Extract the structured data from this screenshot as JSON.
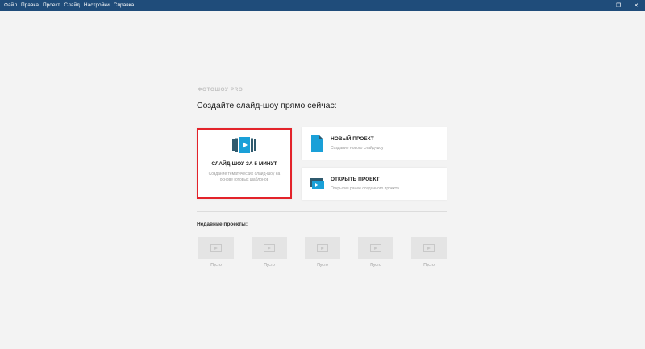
{
  "menu": [
    "Файл",
    "Правка",
    "Проект",
    "Слайд",
    "Настройки",
    "Справка"
  ],
  "window_controls": {
    "minimize": "—",
    "maximize": "❐",
    "close": "✕"
  },
  "brand": "ФОТОШОУ PRO",
  "heading": "Создайте слайд-шоу прямо сейчас:",
  "quick": {
    "title": "СЛАЙД-ШОУ ЗА 5 МИНУТ",
    "desc": "Создание тематических слайд-шоу на основе готовых шаблонов",
    "icon": "slideshow-film-icon"
  },
  "new_project": {
    "title": "НОВЫЙ ПРОЕКТ",
    "sub": "Создание нового слайд-шоу",
    "icon": "new-file-icon"
  },
  "open_project": {
    "title": "ОТКРЫТЬ ПРОЕКТ",
    "sub": "Открытие ранее созданного проекта",
    "icon": "open-folder-icon"
  },
  "recent": {
    "label": "Недавние проекты:",
    "slots": [
      "Пусто",
      "Пусто",
      "Пусто",
      "Пусто",
      "Пусто"
    ]
  },
  "colors": {
    "titlebar": "#1f4c7a",
    "accent": "#1aa0d8",
    "highlight_border": "#e3232a",
    "dark_slate": "#2f5a6e"
  }
}
